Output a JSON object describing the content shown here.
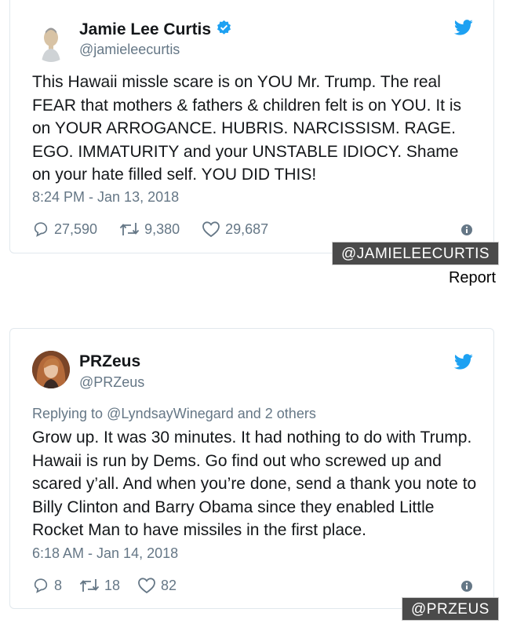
{
  "tweets": [
    {
      "name": "Jamie Lee Curtis",
      "handle": "@jamieleecurtis",
      "verified": true,
      "reply_prefix": "",
      "reply_target": "",
      "reply_suffix": "",
      "text": "This Hawaii missle scare is on YOU Mr. Trump. The real FEAR that mothers & fathers & children felt is on YOU. It is on YOUR ARROGANCE. HUBRIS. NARCISSISM. RAGE. EGO. IMMATURITY and your UNSTABLE IDIOCY. Shame on your hate filled self. YOU DID THIS!",
      "time": "8:24 PM - Jan 13, 2018",
      "replies": "27,590",
      "retweets": "9,380",
      "likes": "29,687",
      "overlay_tag": "@JAMIELEECURTIS"
    },
    {
      "name": "PRZeus",
      "handle": "@PRZeus",
      "verified": false,
      "reply_prefix": "Replying to ",
      "reply_target": "@LyndsayWinegard",
      "reply_suffix": " and 2 others",
      "text": "Grow up. It was 30 minutes. It had nothing to do with Trump. Hawaii is run by Dems. Go find out who screwed up and scared y’all. And when you’re done, send a thank you note to Billy Clinton and Barry Obama since they enabled Little Rocket Man to have missiles in the first place.",
      "time": "6:18 AM - Jan 14, 2018",
      "replies": "8",
      "retweets": "18",
      "likes": "82",
      "overlay_tag": "@PRZEUS"
    }
  ],
  "report_link": "Report",
  "colors": {
    "twitter_blue": "#1da1f2",
    "secondary_text": "#657786",
    "tag_background": "#4a4a4a"
  },
  "icons": [
    "verified-badge-icon",
    "twitter-bird-icon",
    "reply-icon",
    "retweet-icon",
    "like-icon",
    "info-icon"
  ]
}
